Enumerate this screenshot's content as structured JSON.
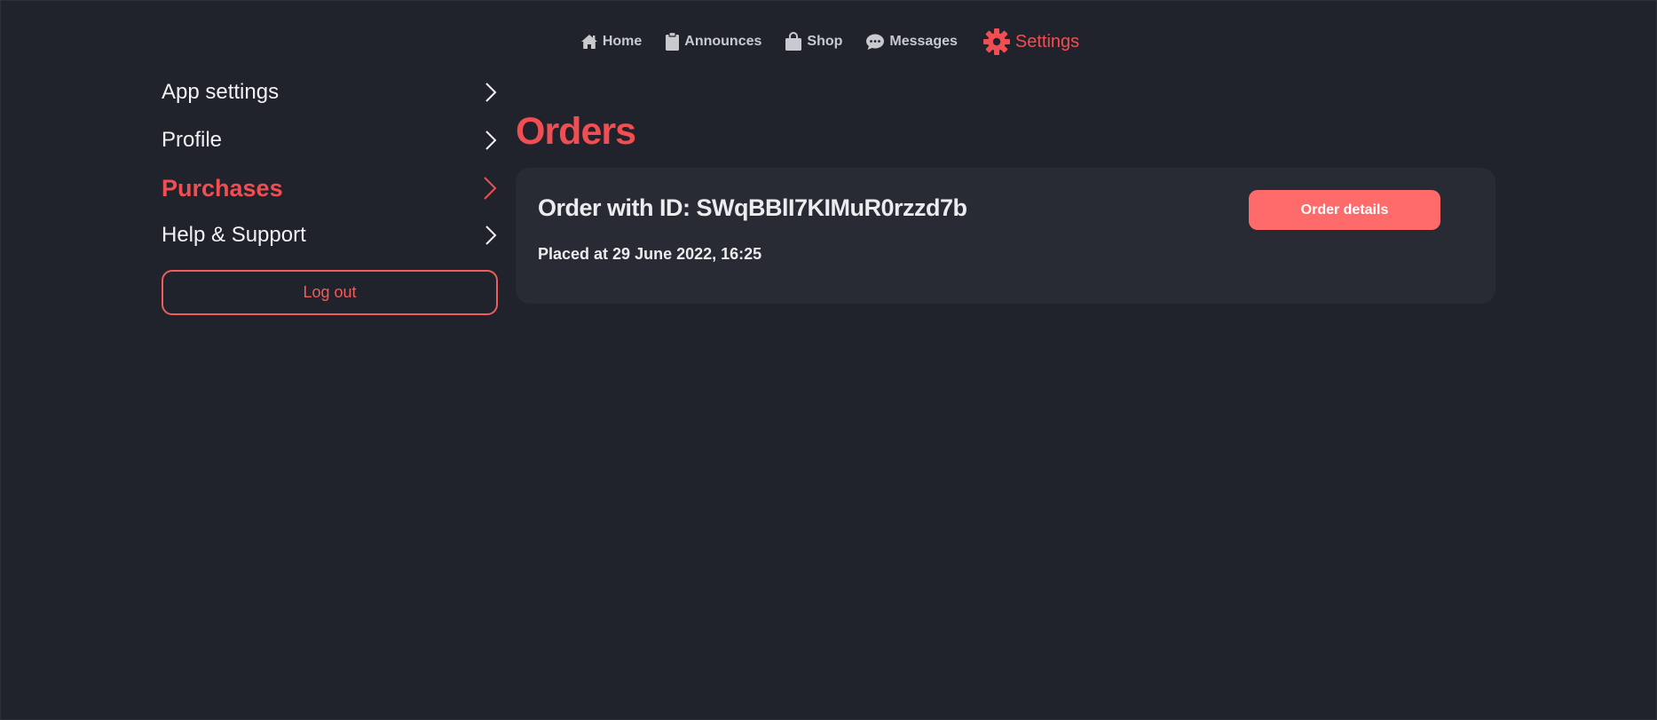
{
  "nav": {
    "items": [
      {
        "label": "Home",
        "icon": "home-icon"
      },
      {
        "label": "Announces",
        "icon": "clipboard-icon"
      },
      {
        "label": "Shop",
        "icon": "shopping-bag-icon"
      },
      {
        "label": "Messages",
        "icon": "chat-bubble-icon"
      },
      {
        "label": "Settings",
        "icon": "gear-icon"
      }
    ],
    "active": "Settings"
  },
  "sidebar": {
    "items": [
      {
        "label": "App settings"
      },
      {
        "label": "Profile"
      },
      {
        "label": "Purchases"
      },
      {
        "label": "Help & Support"
      }
    ],
    "active": "Purchases",
    "logout_label": "Log out"
  },
  "main": {
    "title": "Orders",
    "orders": [
      {
        "id_text": "Order with ID: SWqBBlI7KIMuR0rzzd7b",
        "placed_text": "Placed at 29 June 2022, 16:25",
        "button_label": "Order details"
      }
    ]
  },
  "colors": {
    "background": "#20232b",
    "card": "#282b34",
    "accent": "#f04e52",
    "button": "#ff6b6b",
    "nav_text": "#c9cad0"
  }
}
